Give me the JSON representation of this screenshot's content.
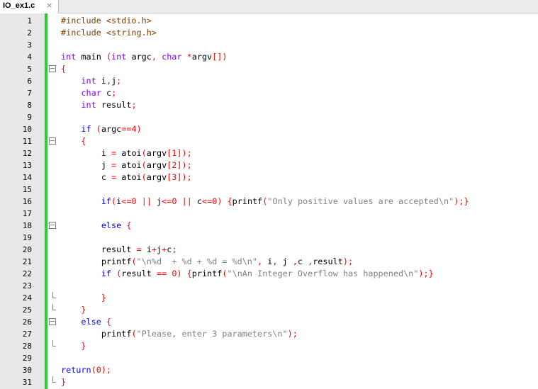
{
  "tab": {
    "filename": "IO_ex1.c",
    "close_icon": "×"
  },
  "lines": [
    {
      "n": "1",
      "code": "#include <stdio.h>",
      "fold": ""
    },
    {
      "n": "2",
      "code": "#include <string.h>",
      "fold": ""
    },
    {
      "n": "3",
      "code": "",
      "fold": ""
    },
    {
      "n": "4",
      "code": "int main (int argc, char *argv[])",
      "fold": ""
    },
    {
      "n": "5",
      "code": "{",
      "fold": "box"
    },
    {
      "n": "6",
      "code": "    int i,j;",
      "fold": ""
    },
    {
      "n": "7",
      "code": "    char c;",
      "fold": ""
    },
    {
      "n": "8",
      "code": "    int result;",
      "fold": ""
    },
    {
      "n": "9",
      "code": "",
      "fold": ""
    },
    {
      "n": "10",
      "code": "    if (argc==4)",
      "fold": ""
    },
    {
      "n": "11",
      "code": "    {",
      "fold": "box"
    },
    {
      "n": "12",
      "code": "        i = atoi(argv[1]);",
      "fold": ""
    },
    {
      "n": "13",
      "code": "        j = atoi(argv[2]);",
      "fold": ""
    },
    {
      "n": "14",
      "code": "        c = atoi(argv[3]);",
      "fold": ""
    },
    {
      "n": "15",
      "code": "",
      "fold": ""
    },
    {
      "n": "16",
      "code": "        if(i<=0 || j<=0 || c<=0) {printf(\"Only positive values are accepted\\n\");}",
      "fold": ""
    },
    {
      "n": "17",
      "code": "",
      "fold": ""
    },
    {
      "n": "18",
      "code": "        else {",
      "fold": "box"
    },
    {
      "n": "19",
      "code": "",
      "fold": ""
    },
    {
      "n": "20",
      "code": "        result = i+j+c;",
      "fold": ""
    },
    {
      "n": "21",
      "code": "        printf(\"\\n%d  + %d + %d = %d\\n\", i, j ,c ,result);",
      "fold": ""
    },
    {
      "n": "22",
      "code": "        if (result == 0) {printf(\"\\nAn Integer Overflow has happened\\n\");}",
      "fold": ""
    },
    {
      "n": "23",
      "code": "",
      "fold": ""
    },
    {
      "n": "24",
      "code": "        }",
      "fold": "end"
    },
    {
      "n": "25",
      "code": "    }",
      "fold": "end"
    },
    {
      "n": "26",
      "code": "    else {",
      "fold": "box"
    },
    {
      "n": "27",
      "code": "        printf(\"Please, enter 3 parameters\\n\");",
      "fold": ""
    },
    {
      "n": "28",
      "code": "    }",
      "fold": "end"
    },
    {
      "n": "29",
      "code": "",
      "fold": ""
    },
    {
      "n": "30",
      "code": "return(0);",
      "fold": ""
    },
    {
      "n": "31",
      "code": "}",
      "fold": "end"
    }
  ],
  "colors": {
    "keyword": "#0000ff",
    "type": "#8000ff",
    "preprocessor": "#804000",
    "operator": "#ff0000",
    "string": "#808080",
    "change_bar": "#28d028"
  }
}
